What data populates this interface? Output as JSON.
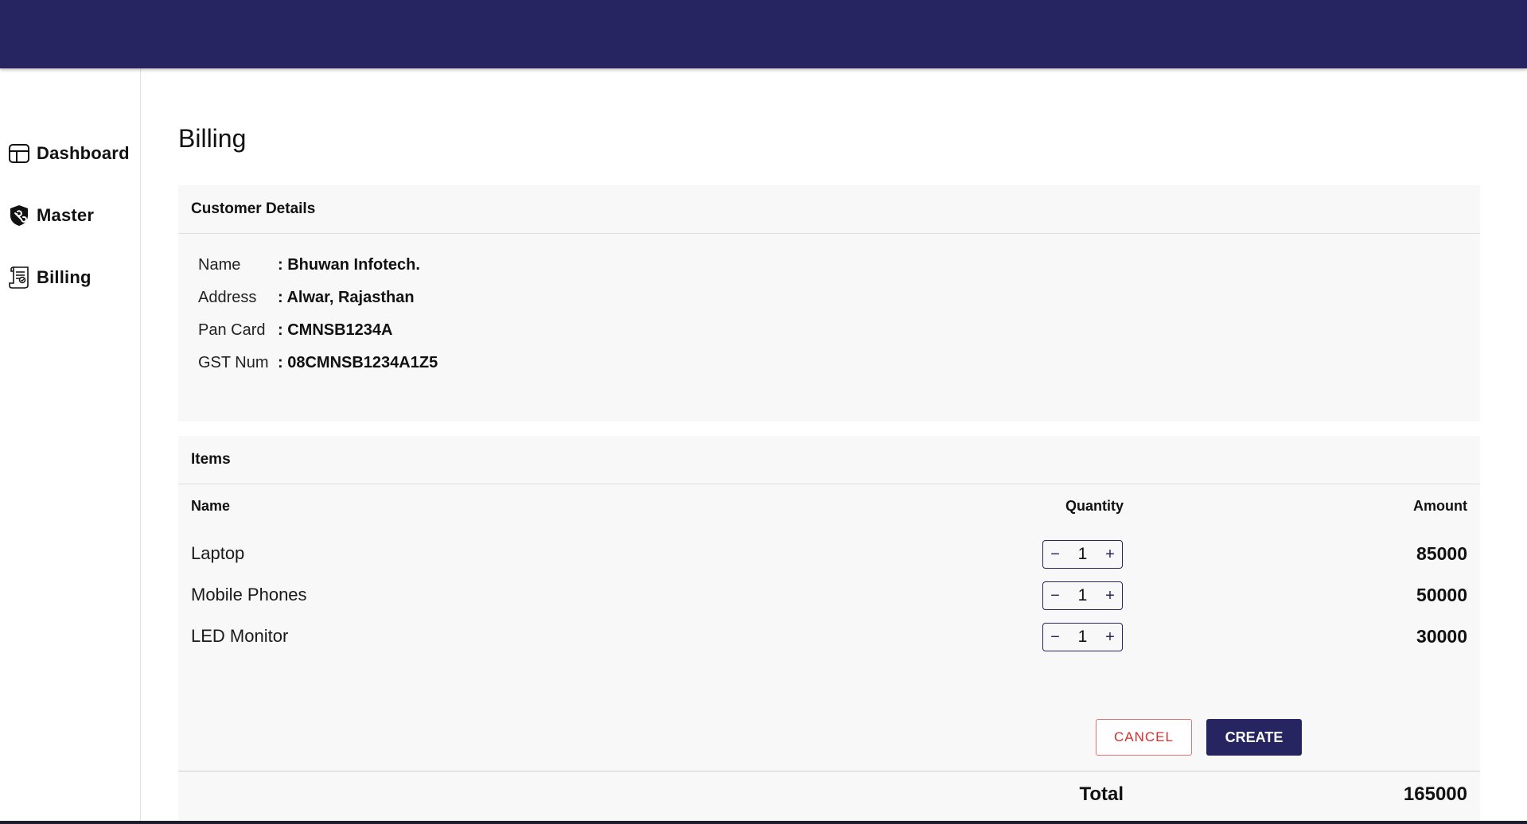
{
  "colors": {
    "primary": "#262562",
    "card_background": "#f8f8f8",
    "cancel": "#d32f2f"
  },
  "sidebar": {
    "items": [
      {
        "label": "Dashboard",
        "icon": "dashboard-icon"
      },
      {
        "label": "Master",
        "icon": "shield-icon"
      },
      {
        "label": "Billing",
        "icon": "invoice-icon"
      }
    ]
  },
  "page": {
    "title": "Billing"
  },
  "customer": {
    "header": "Customer Details",
    "fields": [
      {
        "label": "Name",
        "value": ": Bhuwan Infotech."
      },
      {
        "label": "Address",
        "value": ": Alwar, Rajasthan"
      },
      {
        "label": "Pan Card",
        "value": ": CMNSB1234A"
      },
      {
        "label": "GST Num",
        "value": ": 08CMNSB1234A1Z5"
      }
    ]
  },
  "items": {
    "header": "Items",
    "columns": {
      "name": "Name",
      "quantity": "Quantity",
      "amount": "Amount"
    },
    "rows": [
      {
        "name": "Laptop",
        "quantity": "1",
        "amount": "85000"
      },
      {
        "name": "Mobile Phones",
        "quantity": "1",
        "amount": "50000"
      },
      {
        "name": "LED Monitor",
        "quantity": "1",
        "amount": "30000"
      }
    ],
    "stepper": {
      "minus": "−",
      "plus": "+"
    },
    "total_label": "Total",
    "total_value": "165000"
  },
  "actions": {
    "cancel_label": "CANCEL",
    "create_label": "CREATE"
  }
}
